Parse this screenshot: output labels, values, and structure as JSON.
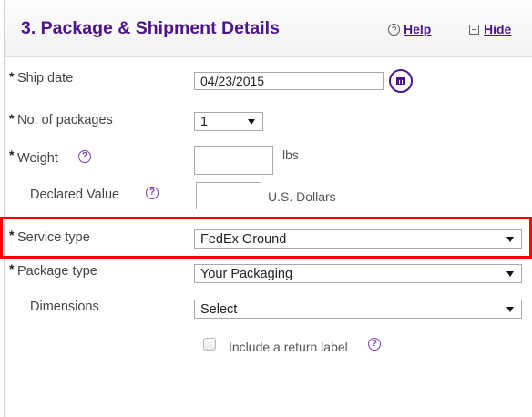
{
  "header": {
    "title": "3. Package & Shipment Details",
    "help_label": "Help",
    "hide_label": "Hide"
  },
  "form": {
    "required_mark": "*",
    "ship_date": {
      "label": "Ship date",
      "value": "04/23/2015"
    },
    "num_packages": {
      "label": "No. of packages",
      "value": "1"
    },
    "weight": {
      "label": "Weight",
      "value": "",
      "unit": "lbs"
    },
    "declared_value": {
      "label": "Declared Value",
      "value": "",
      "unit": "U.S. Dollars"
    },
    "service_type": {
      "label": "Service type",
      "value": "FedEx Ground"
    },
    "package_type": {
      "label": "Package type",
      "value": "Your Packaging"
    },
    "dimensions": {
      "label": "Dimensions",
      "value": "Select"
    },
    "return_label": {
      "label": "Include a return label",
      "checked": false
    }
  },
  "colors": {
    "brand_purple": "#4d148c",
    "highlight_red": "#ff0000"
  }
}
